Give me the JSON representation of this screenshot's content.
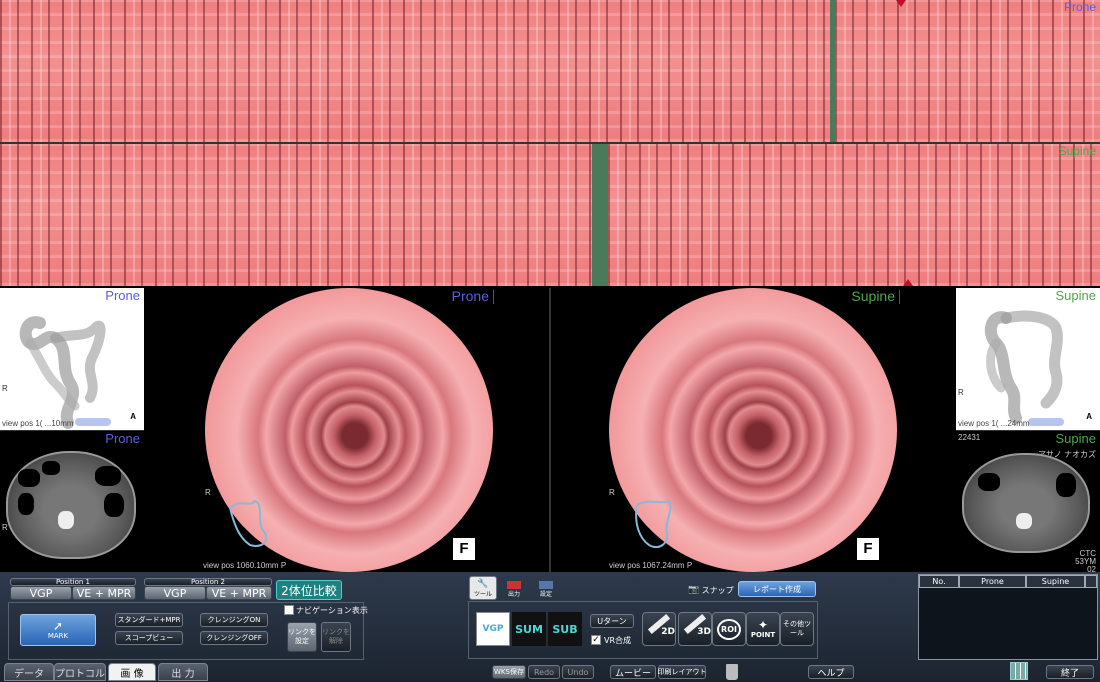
{
  "strips": {
    "top_label": "Prone",
    "bottom_label": "Supine",
    "top_label_color": "#5c5ce0",
    "bottom_label_color": "#4ca84c"
  },
  "viewers": {
    "left_overview_label": "Prone",
    "left_overview_pos": "view pos 1( ...10mm",
    "left_overview_a": "A",
    "left_overview_r": "R",
    "left_ct_label": "Prone",
    "left_endo_label": "Prone",
    "left_endo_pos": "view pos 1060.10mm   P",
    "left_endo_r": "R",
    "right_endo_label": "Supine",
    "right_endo_pos": "view pos 1067.24mm   P",
    "right_endo_r": "R",
    "right_overview_label": "Supine",
    "right_overview_pos": "view pos 1( ...24mm",
    "right_overview_a": "A",
    "right_overview_r": "R",
    "right_ct_label": "Supine",
    "right_ct_id": "22431",
    "right_ct_name": "アサノ ナオカズ",
    "right_ct_info1": "CTC",
    "right_ct_info2": "53YM",
    "right_ct_info3": "02",
    "f_box": "F",
    "prone_color": "#5c5ce0",
    "supine_color": "#4ca84c"
  },
  "toolbar": {
    "position1_label": "Position 1",
    "position2_label": "Position 2",
    "vgp1": "VGP",
    "vempr1": "VE + MPR",
    "vgp2": "VGP",
    "vempr2": "VE + MPR",
    "compare": "2体位比較",
    "mark": "MARK",
    "standard_mpr": "スタンダード+MPR",
    "scope_view": "スコープビュー",
    "cleansing_on": "クレンジングON",
    "cleansing_off": "クレンジングOFF",
    "nav_display": "ナビゲーション表示",
    "link_set": "リンクを設定",
    "link_release": "リンクを解除",
    "tool_tab": "ツール",
    "output_tab": "出力",
    "settings_tab": "設定",
    "snap": "スナップ",
    "report": "レポート作成",
    "vgp_thumb": "VGP",
    "sum_thumb": "SUM",
    "sub_thumb": "SUB",
    "u_turn": "Uターン",
    "vr_composite": "VR合成",
    "tool_2d": "2D",
    "tool_3d": "3D",
    "tool_roi": "ROI",
    "tool_point": "POINT",
    "tool_other": "その他ツール"
  },
  "bottom_tabs": [
    "データ",
    "プロトコル",
    "画 像",
    "出 力"
  ],
  "bottom_buttons": {
    "wks_save": "WKS保存",
    "redo": "Redo",
    "undo": "Undo",
    "movie": "ムービー",
    "print_layout": "印刷レイアウト",
    "help": "ヘルプ",
    "exit": "終了"
  },
  "table": {
    "headers": [
      "No.",
      "Prone",
      "Supine"
    ]
  }
}
